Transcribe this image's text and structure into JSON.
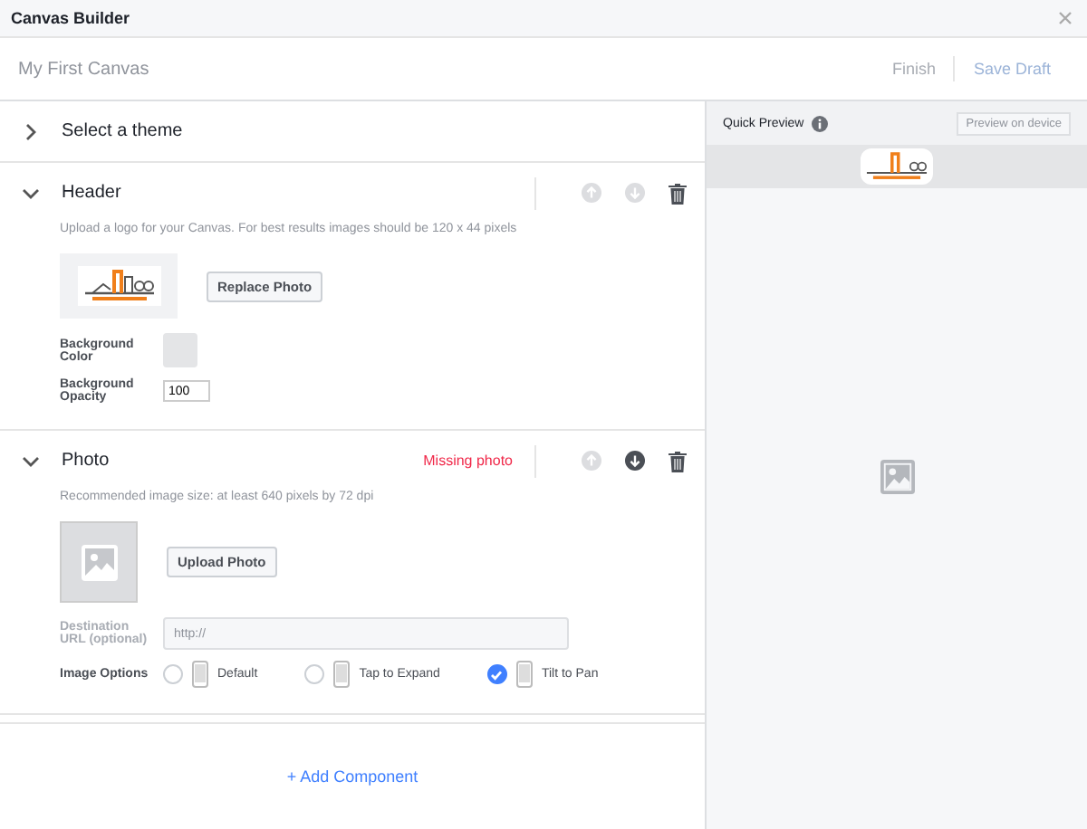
{
  "window": {
    "title": "Canvas Builder"
  },
  "toolbar": {
    "canvas_name": "My First Canvas",
    "buttons": [
      {
        "label": "Finish",
        "disabled": true
      },
      {
        "label": "Save Draft",
        "disabled": false
      }
    ]
  },
  "sections": [
    {
      "kind": "theme",
      "title": "Select a theme",
      "expanded": false
    },
    {
      "kind": "header",
      "title": "Header",
      "expanded": true,
      "up_disabled": true,
      "down_disabled": true,
      "hint": "Upload a logo for your Canvas. For best results images should be 120 x 44 pixels",
      "photo_button": "Replace Photo",
      "color_label": "Background Color",
      "opacity_label": "Background Opacity",
      "opacity_value": "100"
    },
    {
      "kind": "photo",
      "title": "Photo",
      "expanded": true,
      "warning": "Missing photo",
      "up_disabled": true,
      "down_disabled": false,
      "hint": "Recommended image size: at least 640 pixels by 72 dpi",
      "photo_button": "Upload Photo",
      "url_label": "Destination URL (optional)",
      "url_placeholder": "http://",
      "options_label": "Image Options",
      "options": [
        {
          "label": "Default",
          "selected": false
        },
        {
          "label": "Tap to Expand",
          "selected": false
        },
        {
          "label": "Tilt to Pan",
          "selected": true
        }
      ]
    }
  ],
  "add_component": "+ Add Component",
  "preview": {
    "title": "Quick Preview",
    "button": "Preview on device"
  }
}
